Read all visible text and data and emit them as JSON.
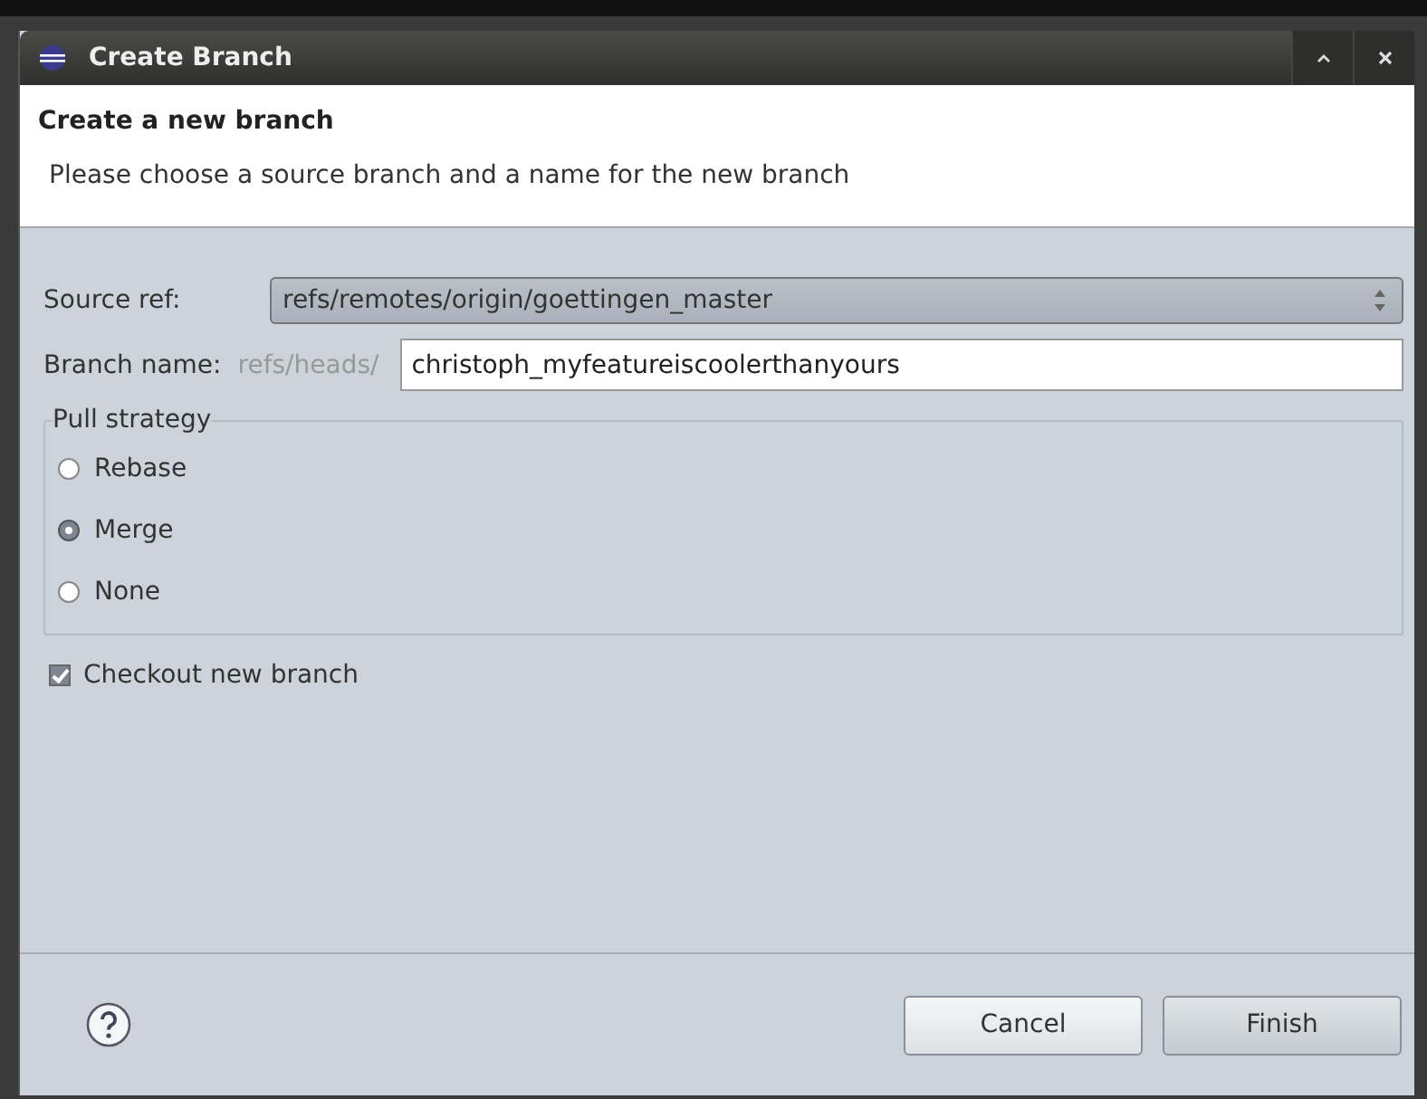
{
  "window": {
    "title": "Create Branch"
  },
  "header": {
    "title": "Create a new branch",
    "description": "Please choose a source branch and a name for the new branch"
  },
  "source_ref": {
    "label": "Source ref:",
    "value": "refs/remotes/origin/goettingen_master"
  },
  "branch_name": {
    "label": "Branch name:",
    "prefix": "refs/heads/",
    "value": "christoph_myfeatureiscoolerthanyours"
  },
  "pull_strategy": {
    "title": "Pull strategy",
    "options": [
      {
        "label": "Rebase",
        "selected": false
      },
      {
        "label": "Merge",
        "selected": true
      },
      {
        "label": "None",
        "selected": false
      }
    ]
  },
  "checkout": {
    "label": "Checkout new branch",
    "checked": true
  },
  "buttons": [
    {
      "label": "Cancel",
      "default": false
    },
    {
      "label": "Finish",
      "default": true
    }
  ]
}
